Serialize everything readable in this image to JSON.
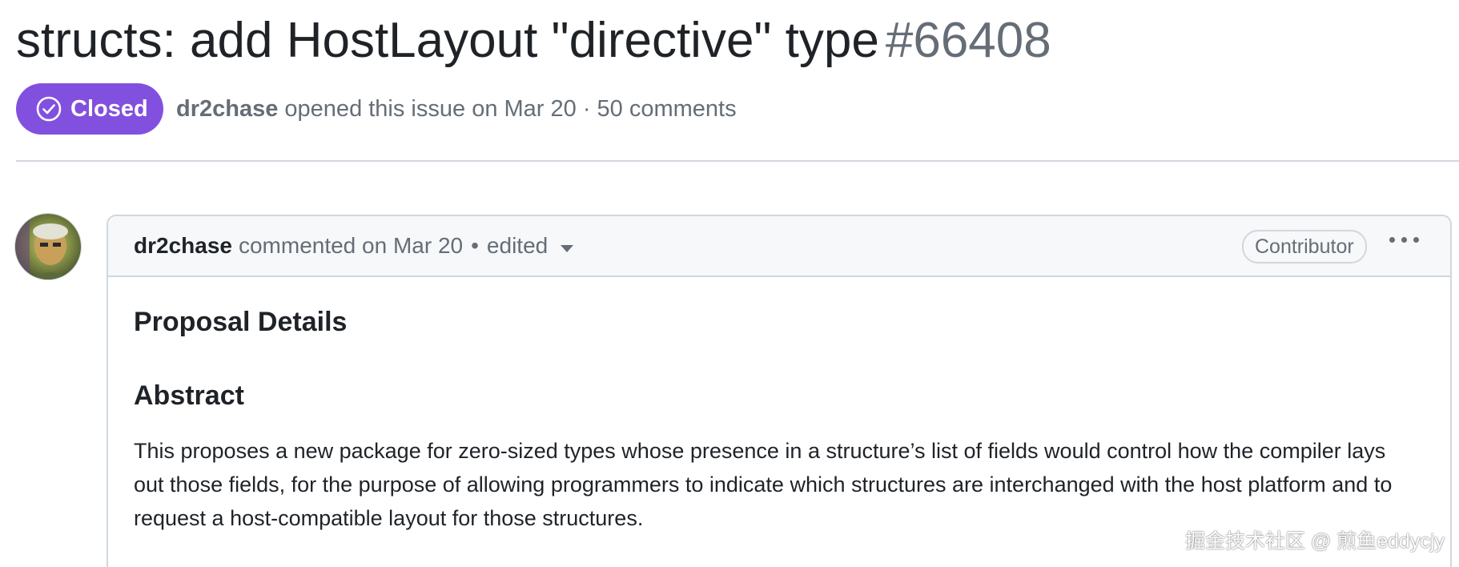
{
  "issue": {
    "title": "structs: add HostLayout \"directive\" type",
    "number": "#66408",
    "state": "Closed",
    "author": "dr2chase",
    "meta_text": "opened this issue on Mar 20 · 50 comments"
  },
  "comment": {
    "author": "dr2chase",
    "action_text": "commented on Mar 20",
    "separator": "•",
    "edited_label": "edited",
    "role_badge": "Contributor",
    "heading_1": "Proposal Details",
    "heading_2": "Abstract",
    "paragraph": "This proposes a new package for zero-sized types whose presence in a structure’s list of fields would control how the compiler lays out those fields, for the purpose of allowing programmers to indicate which structures are interchanged with the host platform and to request a host-compatible layout for those structures."
  },
  "watermark": "掘金技术社区 @ 煎鱼eddycjy",
  "colors": {
    "closed_badge": "#8250df",
    "muted_text": "#656d76",
    "border": "#d0d7de",
    "header_bg": "#f6f8fa"
  },
  "icons": {
    "state": "check-circle-icon",
    "caret": "caret-down-icon",
    "menu": "kebab-horizontal-icon"
  }
}
